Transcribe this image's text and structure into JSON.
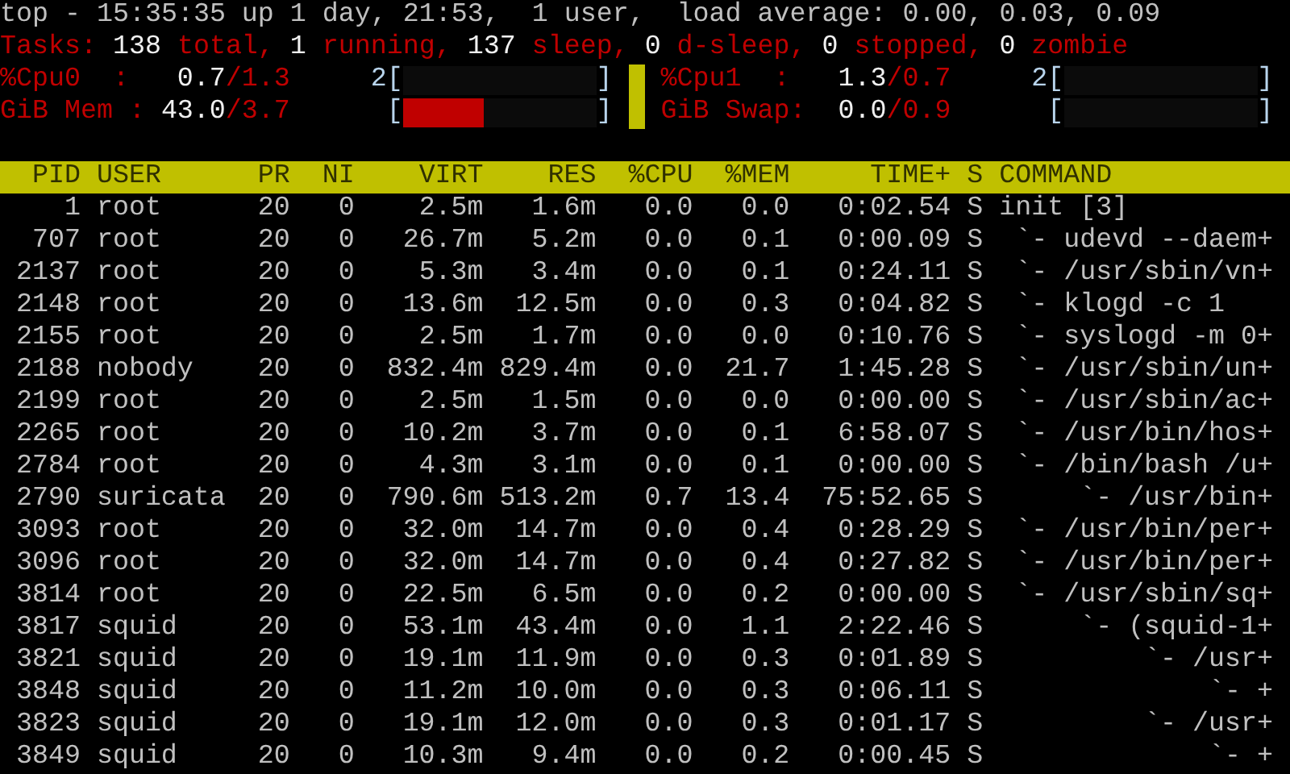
{
  "uptime_line": "top - 15:35:35 up 1 day, 21:53,  1 user,  load average: 0.00, 0.03, 0.09",
  "tasks_line": [
    {
      "text": "Tasks:",
      "kind": "label"
    },
    {
      "text": "138",
      "kind": "value"
    },
    {
      "text": "total,",
      "kind": "label"
    },
    {
      "text": "1",
      "kind": "value"
    },
    {
      "text": "running,",
      "kind": "label"
    },
    {
      "text": "137",
      "kind": "value"
    },
    {
      "text": "sleep,",
      "kind": "label"
    },
    {
      "text": "0",
      "kind": "value"
    },
    {
      "text": "d-sleep,",
      "kind": "label"
    },
    {
      "text": "0",
      "kind": "value"
    },
    {
      "text": "stopped,",
      "kind": "label"
    },
    {
      "text": "0",
      "kind": "value"
    },
    {
      "text": "zombie",
      "kind": "label"
    }
  ],
  "meters": [
    {
      "label": "%Cpu0  :",
      "value": "0.7",
      "limit": "/1.3",
      "open": "2[",
      "close": "]",
      "level": 0
    },
    {
      "label": "%Cpu1  :",
      "value": "1.3",
      "limit": "/0.7",
      "open": "2[",
      "close": "]",
      "level": 0
    },
    {
      "label": "GiB Mem :",
      "value": "43.0",
      "limit": "/3.7",
      "open": "[",
      "close": "]",
      "level": 0.42
    },
    {
      "label": "GiB Swap:",
      "value": "0.0",
      "limit": "/0.9",
      "open": "[",
      "close": "]",
      "level": 0
    }
  ],
  "columns": [
    "PID",
    "USER",
    "PR",
    "NI",
    "VIRT",
    "RES",
    "%CPU",
    "%MEM",
    "TIME+",
    "S",
    "COMMAND"
  ],
  "processes": [
    {
      "pid": "1",
      "user": "root",
      "pr": "20",
      "ni": "0",
      "virt": "2.5m",
      "res": "1.6m",
      "cpu": "0.0",
      "mem": "0.0",
      "time": "0:02.54",
      "state": "S",
      "command": "init [3]",
      "children": [
        {
          "pid": "707",
          "user": "root",
          "pr": "20",
          "ni": "0",
          "virt": "26.7m",
          "res": "5.2m",
          "cpu": "0.0",
          "mem": "0.1",
          "time": "0:00.09",
          "state": "S",
          "command": "`- udevd --daem+"
        },
        {
          "pid": "2137",
          "user": "root",
          "pr": "20",
          "ni": "0",
          "virt": "5.3m",
          "res": "3.4m",
          "cpu": "0.0",
          "mem": "0.1",
          "time": "0:24.11",
          "state": "S",
          "command": "`- /usr/sbin/vn+"
        },
        {
          "pid": "2148",
          "user": "root",
          "pr": "20",
          "ni": "0",
          "virt": "13.6m",
          "res": "12.5m",
          "cpu": "0.0",
          "mem": "0.3",
          "time": "0:04.82",
          "state": "S",
          "command": "`- klogd -c 1"
        },
        {
          "pid": "2155",
          "user": "root",
          "pr": "20",
          "ni": "0",
          "virt": "2.5m",
          "res": "1.7m",
          "cpu": "0.0",
          "mem": "0.0",
          "time": "0:10.76",
          "state": "S",
          "command": "`- syslogd -m 0+"
        },
        {
          "pid": "2188",
          "user": "nobody",
          "pr": "20",
          "ni": "0",
          "virt": "832.4m",
          "res": "829.4m",
          "cpu": "0.0",
          "mem": "21.7",
          "time": "1:45.28",
          "state": "S",
          "command": "`- /usr/sbin/un+"
        },
        {
          "pid": "2199",
          "user": "root",
          "pr": "20",
          "ni": "0",
          "virt": "2.5m",
          "res": "1.5m",
          "cpu": "0.0",
          "mem": "0.0",
          "time": "0:00.00",
          "state": "S",
          "command": "`- /usr/sbin/ac+"
        },
        {
          "pid": "2265",
          "user": "root",
          "pr": "20",
          "ni": "0",
          "virt": "10.2m",
          "res": "3.7m",
          "cpu": "0.0",
          "mem": "0.1",
          "time": "6:58.07",
          "state": "S",
          "command": "`- /usr/bin/hos+"
        },
        {
          "pid": "2784",
          "user": "root",
          "pr": "20",
          "ni": "0",
          "virt": "4.3m",
          "res": "3.1m",
          "cpu": "0.0",
          "mem": "0.1",
          "time": "0:00.00",
          "state": "S",
          "command": "`- /bin/bash /u+",
          "children": [
            {
              "pid": "2790",
              "user": "suricata",
              "pr": "20",
              "ni": "0",
              "virt": "790.6m",
              "res": "513.2m",
              "cpu": "0.7",
              "mem": "13.4",
              "time": "75:52.65",
              "state": "S",
              "command": "`- /usr/bin+"
            }
          ]
        },
        {
          "pid": "3093",
          "user": "root",
          "pr": "20",
          "ni": "0",
          "virt": "32.0m",
          "res": "14.7m",
          "cpu": "0.0",
          "mem": "0.4",
          "time": "0:28.29",
          "state": "S",
          "command": "`- /usr/bin/per+"
        },
        {
          "pid": "3096",
          "user": "root",
          "pr": "20",
          "ni": "0",
          "virt": "32.0m",
          "res": "14.7m",
          "cpu": "0.0",
          "mem": "0.4",
          "time": "0:27.82",
          "state": "S",
          "command": "`- /usr/bin/per+"
        },
        {
          "pid": "3814",
          "user": "root",
          "pr": "20",
          "ni": "0",
          "virt": "22.5m",
          "res": "6.5m",
          "cpu": "0.0",
          "mem": "0.2",
          "time": "0:00.00",
          "state": "S",
          "command": "`- /usr/sbin/sq+",
          "children": [
            {
              "pid": "3817",
              "user": "squid",
              "pr": "20",
              "ni": "0",
              "virt": "53.1m",
              "res": "43.4m",
              "cpu": "0.0",
              "mem": "1.1",
              "time": "2:22.46",
              "state": "S",
              "command": "`- (squid-1+",
              "children": [
                {
                  "pid": "3821",
                  "user": "squid",
                  "pr": "20",
                  "ni": "0",
                  "virt": "19.1m",
                  "res": "11.9m",
                  "cpu": "0.0",
                  "mem": "0.3",
                  "time": "0:01.89",
                  "state": "S",
                  "command": "`- /usr+",
                  "children": [
                    {
                      "pid": "3848",
                      "user": "squid",
                      "pr": "20",
                      "ni": "0",
                      "virt": "11.2m",
                      "res": "10.0m",
                      "cpu": "0.0",
                      "mem": "0.3",
                      "time": "0:06.11",
                      "state": "S",
                      "command": "`- +"
                    }
                  ]
                },
                {
                  "pid": "3823",
                  "user": "squid",
                  "pr": "20",
                  "ni": "0",
                  "virt": "19.1m",
                  "res": "12.0m",
                  "cpu": "0.0",
                  "mem": "0.3",
                  "time": "0:01.17",
                  "state": "S",
                  "command": "`- /usr+",
                  "children": [
                    {
                      "pid": "3849",
                      "user": "squid",
                      "pr": "20",
                      "ni": "0",
                      "virt": "10.3m",
                      "res": "9.4m",
                      "cpu": "0.0",
                      "mem": "0.2",
                      "time": "0:00.45",
                      "state": "S",
                      "command": "`- +"
                    }
                  ]
                }
              ]
            }
          ]
        }
      ]
    }
  ]
}
